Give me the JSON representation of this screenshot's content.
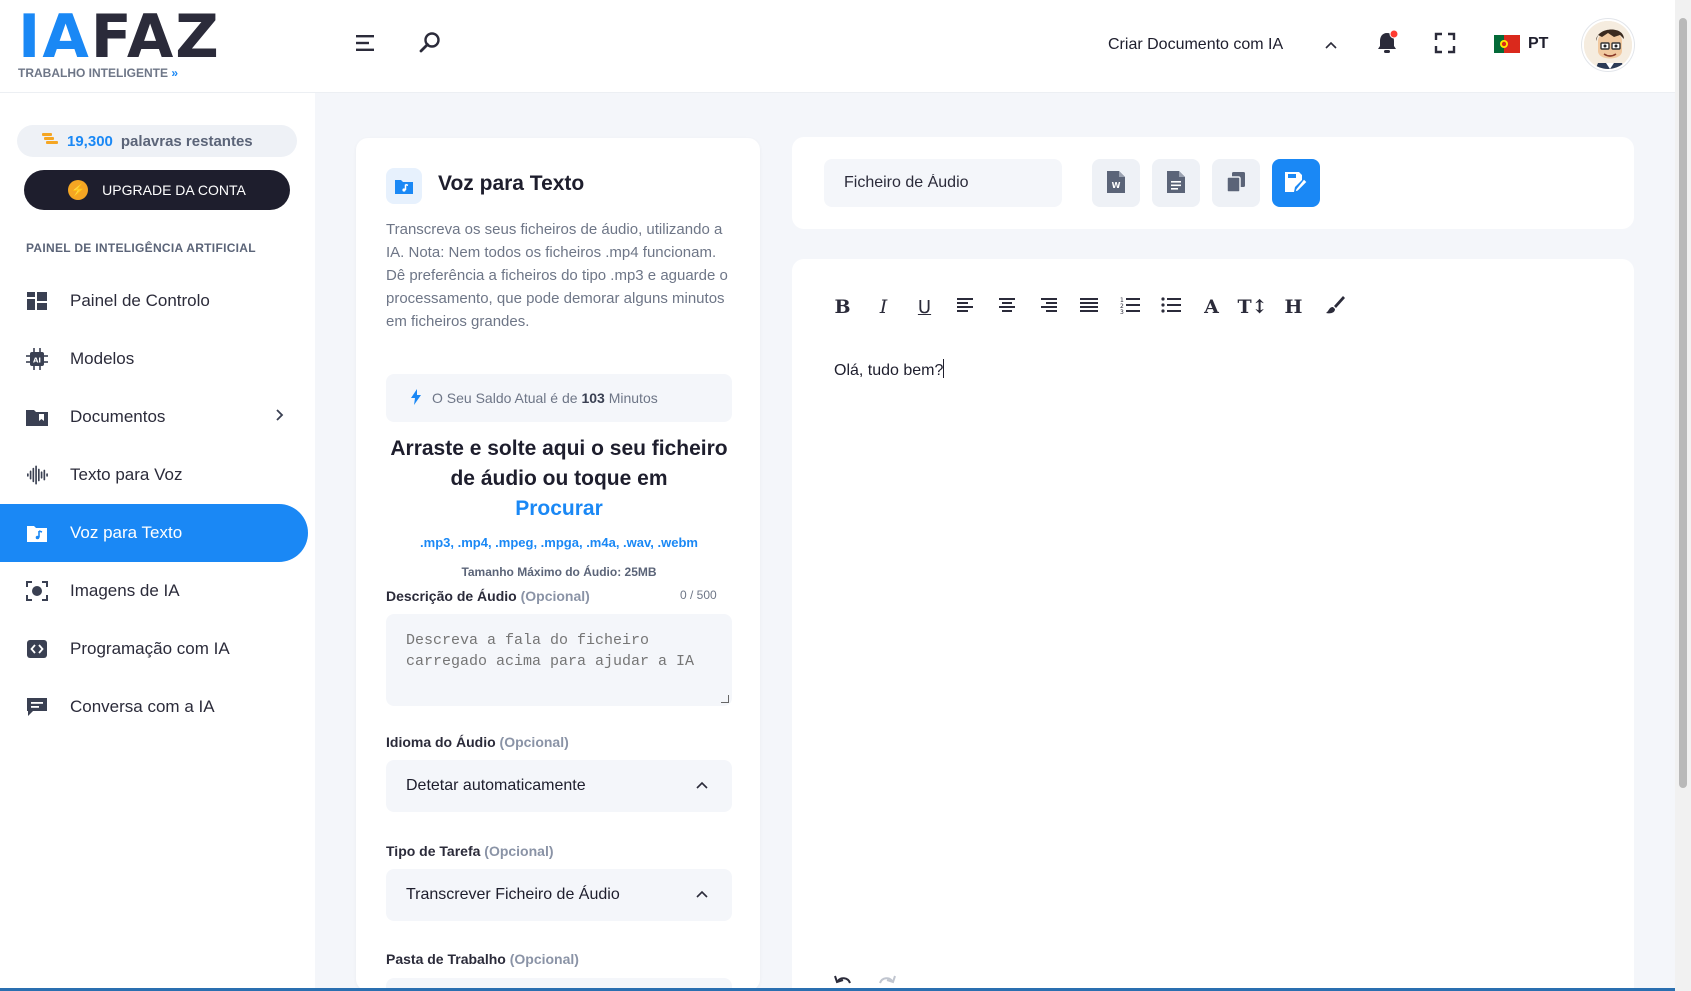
{
  "header": {
    "logo_main_ia": "IA",
    "logo_main_faz": "FAZ",
    "logo_sub": "TRABALHO INTELIGENTE",
    "create_doc_label": "Criar Documento com IA",
    "language_code": "PT"
  },
  "sidebar": {
    "words_count": "19,300",
    "words_label": "palavras restantes",
    "upgrade_label": "UPGRADE DA CONTA",
    "section_label": "PAINEL DE INTELIGÊNCIA ARTIFICIAL",
    "items": [
      {
        "label": "Painel de Controlo",
        "icon": "dashboard-icon"
      },
      {
        "label": "Modelos",
        "icon": "ai-chip-icon"
      },
      {
        "label": "Documentos",
        "icon": "folder-icon"
      },
      {
        "label": "Texto para Voz",
        "icon": "waveform-icon"
      },
      {
        "label": "Voz para Texto",
        "icon": "audio-file-icon",
        "active": true
      },
      {
        "label": "Imagens de IA",
        "icon": "camera-icon"
      },
      {
        "label": "Programação com IA",
        "icon": "code-icon"
      },
      {
        "label": "Conversa com a IA",
        "icon": "chat-icon"
      }
    ]
  },
  "left_panel": {
    "title": "Voz para Texto",
    "description": "Transcreva os seus ficheiros de áudio, utilizando a IA. Nota: Nem todos os ficheiros .mp4 funcionam. Dê preferência a ficheiros do tipo .mp3 e aguarde o processamento, que pode demorar alguns minutos em ficheiros grandes.",
    "balance_prefix": "O Seu Saldo Atual é de",
    "balance_value": "103",
    "balance_suffix": "Minutos",
    "drop_title": "Arraste e solte aqui o seu ficheiro de áudio ou toque em",
    "browse_label": "Procurar",
    "formats": ".mp3, .mp4, .mpeg, .mpga, .m4a, .wav, .webm",
    "max_size": "Tamanho Máximo do Áudio: 25MB",
    "description_label": "Descrição de Áudio",
    "optional_label": "(Opcional)",
    "description_counter": "0 / 500",
    "description_placeholder": "Descreva a fala do ficheiro carregado acima para ajudar a IA",
    "language_label": "Idioma do Áudio",
    "language_value": "Detetar automaticamente",
    "task_label": "Tipo de Tarefa",
    "task_value": "Transcrever Ficheiro de Áudio",
    "workspace_label": "Pasta de Trabalho"
  },
  "top_card": {
    "file_name_value": "Ficheiro de Áudio"
  },
  "editor": {
    "toolbar": [
      "B",
      "I",
      "U",
      "align-left",
      "align-center",
      "align-right",
      "justify",
      "ordered-list",
      "bullet-list",
      "A",
      "font-size",
      "H",
      "brush"
    ],
    "content": "Olá, tudo bem?"
  },
  "colors": {
    "accent": "#1a88f5",
    "dark": "#1e1e2d",
    "notification": "#ff3b30"
  }
}
